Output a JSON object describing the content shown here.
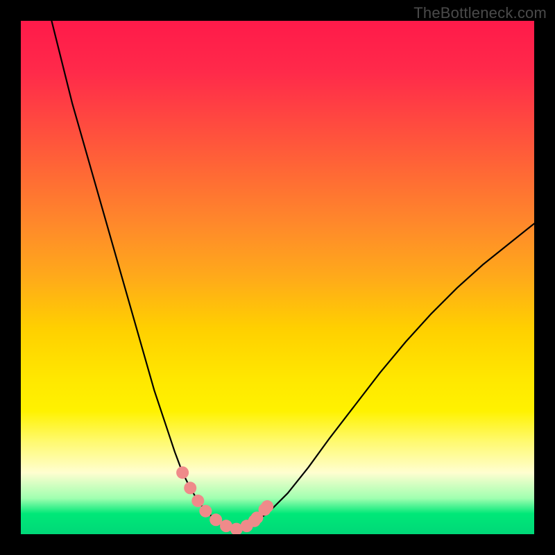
{
  "watermark": "TheBottleneck.com",
  "chart_data": {
    "type": "line",
    "title": "",
    "xlabel": "",
    "ylabel": "",
    "xlim": [
      0,
      100
    ],
    "ylim": [
      0,
      100
    ],
    "grid": false,
    "legend": false,
    "series": [
      {
        "name": "curve",
        "color": "#000000",
        "x": [
          6,
          10,
          14,
          18,
          22,
          26,
          28,
          30,
          31.5,
          33,
          34.5,
          36,
          38,
          40,
          42,
          44,
          48,
          52,
          56,
          60,
          65,
          70,
          75,
          80,
          85,
          90,
          95,
          100
        ],
        "y": [
          100,
          84,
          70,
          56,
          42,
          28,
          22,
          16,
          12,
          9,
          6.5,
          4.5,
          2.8,
          1.6,
          1.0,
          1.6,
          4,
          8,
          13,
          18.5,
          25,
          31.5,
          37.5,
          43,
          48,
          52.5,
          56.5,
          60.5
        ]
      },
      {
        "name": "markers",
        "type": "scatter",
        "color": "#ef8a8a",
        "points": [
          {
            "x": 31.5,
            "y": 12
          },
          {
            "x": 33.0,
            "y": 9
          },
          {
            "x": 34.5,
            "y": 6.5
          },
          {
            "x": 36.0,
            "y": 4.5
          },
          {
            "x": 38.0,
            "y": 2.8
          },
          {
            "x": 40.0,
            "y": 1.6
          },
          {
            "x": 42.0,
            "y": 1.0
          },
          {
            "x": 44.0,
            "y": 1.6
          },
          {
            "x": 45.5,
            "y": 2.6
          },
          {
            "x": 46.0,
            "y": 3.2
          },
          {
            "x": 47.5,
            "y": 4.8
          },
          {
            "x": 48.0,
            "y": 5.4
          }
        ]
      }
    ]
  }
}
